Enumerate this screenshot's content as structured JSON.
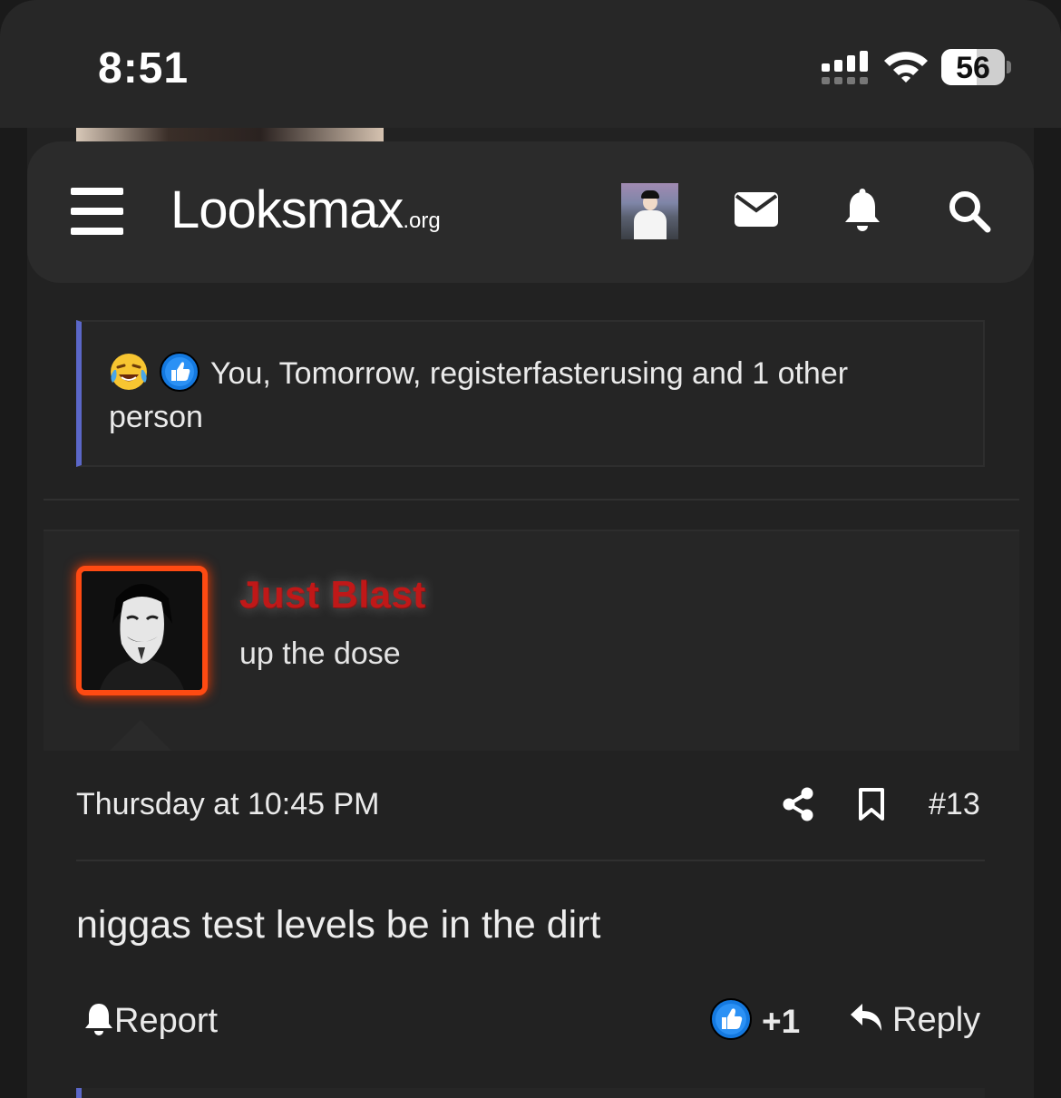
{
  "status_bar": {
    "time": "8:51",
    "battery": "56"
  },
  "header": {
    "logo_main": "Looksmax",
    "logo_suffix": ".org",
    "icons": [
      "menu-icon",
      "mail-icon",
      "bell-icon",
      "search-icon"
    ]
  },
  "reactions": {
    "text": "You, Tomorrow, registerfasterusing and 1 other person",
    "emojis": [
      "laughing-crying-emoji",
      "like-emoji"
    ],
    "accent_color": "#5b67c8"
  },
  "post": {
    "username": "Just Blast",
    "user_title": "up the dose",
    "date": "Thursday at 10:45 PM",
    "number": "#13",
    "body": "niggas test levels be in the dirt",
    "report_label": "Report",
    "like_count": "+1",
    "reply_label": "Reply",
    "username_color": "#c01818",
    "avatar_border_color": "#ff4a12"
  }
}
